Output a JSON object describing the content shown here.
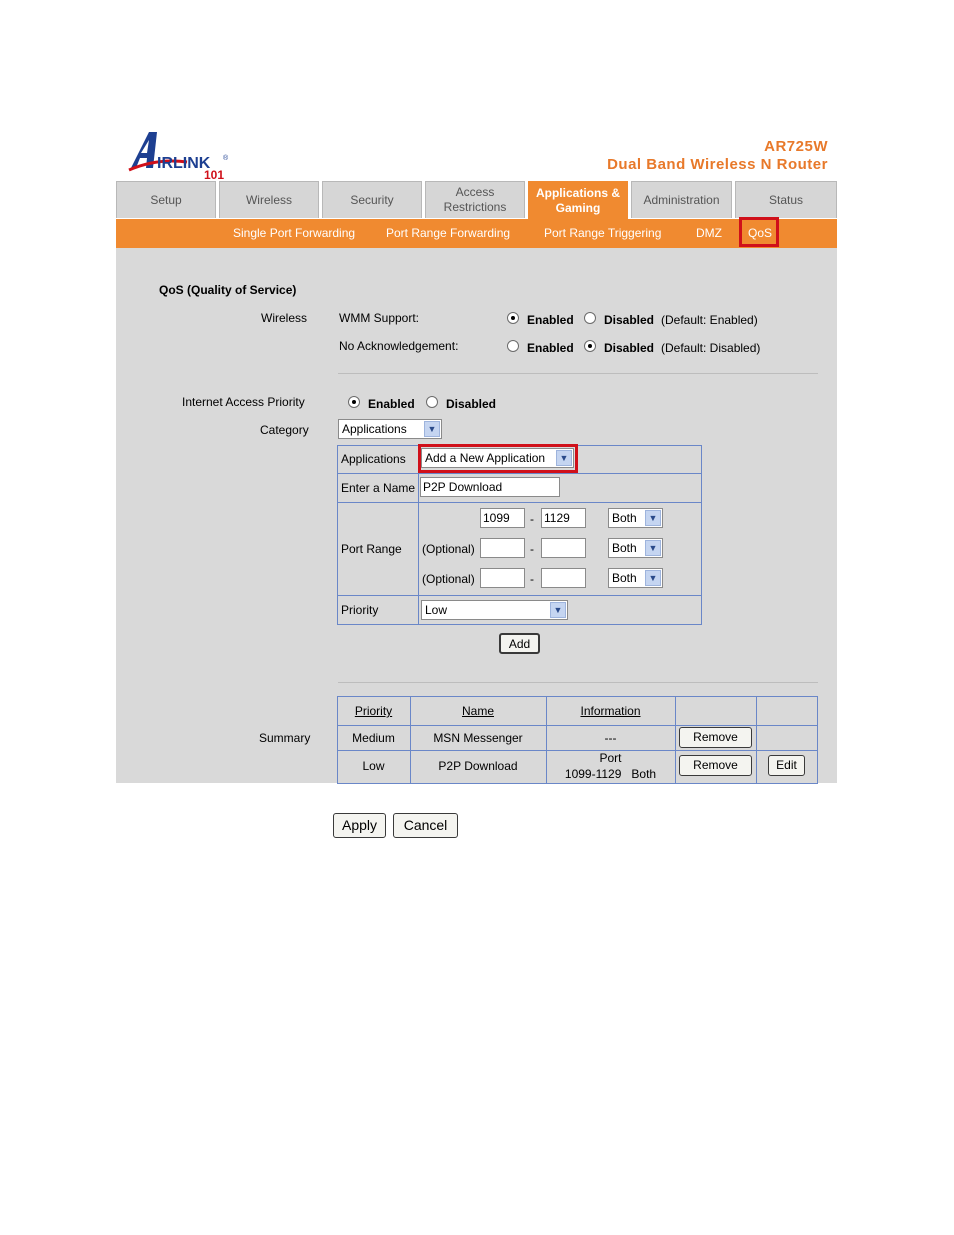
{
  "header": {
    "logo_text": "AIRLINK 101",
    "model": "AR725W",
    "product": "Dual Band Wireless N Router"
  },
  "tabs": [
    {
      "label": "Setup"
    },
    {
      "label": "Wireless"
    },
    {
      "label": "Security"
    },
    {
      "label": "Access Restrictions"
    },
    {
      "label": "Applications & Gaming"
    },
    {
      "label": "Administration"
    },
    {
      "label": "Status"
    }
  ],
  "active_tab": "Applications & Gaming",
  "subnav": [
    {
      "label": "Single Port Forwarding"
    },
    {
      "label": "Port Range Forwarding"
    },
    {
      "label": "Port Range Triggering"
    },
    {
      "label": "DMZ"
    },
    {
      "label": "QoS"
    }
  ],
  "section_title": "QoS (Quality of Service)",
  "wireless": {
    "label": "Wireless",
    "wmm_label": "WMM Support:",
    "wmm_enabled": "Enabled",
    "wmm_disabled": "Disabled",
    "wmm_default": "(Default: Enabled)",
    "noack_label": "No Acknowledgement:",
    "noack_enabled": "Enabled",
    "noack_disabled": "Disabled",
    "noack_default": "(Default: Disabled)"
  },
  "iap": {
    "label": "Internet Access Priority",
    "enabled": "Enabled",
    "disabled": "Disabled",
    "category_label": "Category",
    "category_value": "Applications"
  },
  "form": {
    "applications_label": "Applications",
    "applications_value": "Add a New Application",
    "name_label": "Enter a Name",
    "name_value": "P2P Download",
    "port_range_label": "Port Range",
    "optional": "(Optional)",
    "dash": "-",
    "port_rows": [
      {
        "from": "1099",
        "to": "1129",
        "protocol": "Both"
      },
      {
        "from": "",
        "to": "",
        "protocol": "Both"
      },
      {
        "from": "",
        "to": "",
        "protocol": "Both"
      }
    ],
    "priority_label": "Priority",
    "priority_value": "Low",
    "add_button": "Add"
  },
  "summary": {
    "label": "Summary",
    "headers": [
      "Priority",
      "Name",
      "Information"
    ],
    "rows": [
      {
        "priority": "Medium",
        "name": "MSN Messenger",
        "info_line1": "---",
        "info_line2": "",
        "remove": "Remove",
        "edit": ""
      },
      {
        "priority": "Low",
        "name": "P2P Download",
        "info_line1": "Port",
        "info_line2": "1099-1129   Both",
        "remove": "Remove",
        "edit": "Edit"
      }
    ]
  },
  "footer": {
    "apply": "Apply",
    "cancel": "Cancel"
  },
  "colors": {
    "brand_orange": "#f08a30",
    "highlight_red": "#d0101a",
    "panel_gray": "#d9d9d9",
    "grid_blue": "#6a87c8"
  }
}
